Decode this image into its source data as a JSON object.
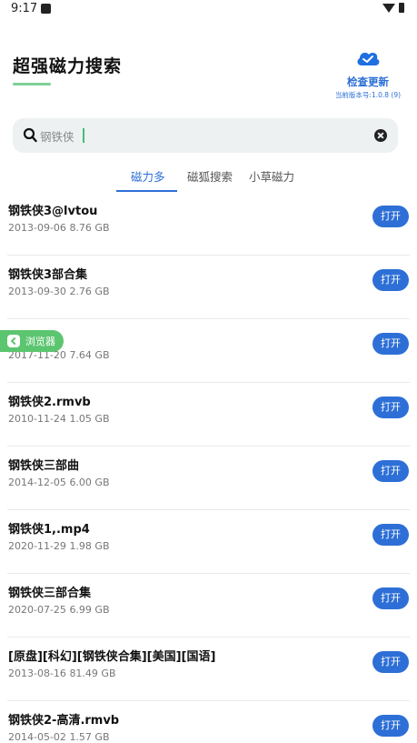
{
  "status_bar": {
    "time": "9:17"
  },
  "header": {
    "title": "超强磁力搜索",
    "update_label": "检查更新",
    "version_label": "当前版本号:1.0.8 (9)"
  },
  "search": {
    "value": "钢铁侠"
  },
  "tabs": [
    {
      "label": "磁力多",
      "active": true
    },
    {
      "label": "磁狐搜索",
      "active": false
    },
    {
      "label": "小草磁力",
      "active": false
    }
  ],
  "open_label": "打开",
  "floating_browser": {
    "label": "浏览器"
  },
  "results": [
    {
      "title": "钢铁侠3@lvtou",
      "date": "2013-09-06",
      "size": "8.76 GB"
    },
    {
      "title": "钢铁侠3部合集",
      "date": "2013-09-30",
      "size": "2.76 GB"
    },
    {
      "title": "",
      "date": "2017-11-20",
      "size": "7.64 GB"
    },
    {
      "title": "钢铁侠2.rmvb",
      "date": "2010-11-24",
      "size": "1.05 GB"
    },
    {
      "title": "钢铁侠三部曲",
      "date": "2014-12-05",
      "size": "6.00 GB"
    },
    {
      "title": "钢铁侠1,.mp4",
      "date": "2020-11-29",
      "size": "1.98 GB"
    },
    {
      "title": "钢铁侠三部合集",
      "date": "2020-07-25",
      "size": "6.99 GB"
    },
    {
      "title": "[原盘][科幻][钢铁侠合集][美国][国语]",
      "date": "2013-08-16",
      "size": "81.49 GB"
    },
    {
      "title": "钢铁侠2-高清.rmvb",
      "date": "2014-05-02",
      "size": "1.57 GB"
    }
  ]
}
